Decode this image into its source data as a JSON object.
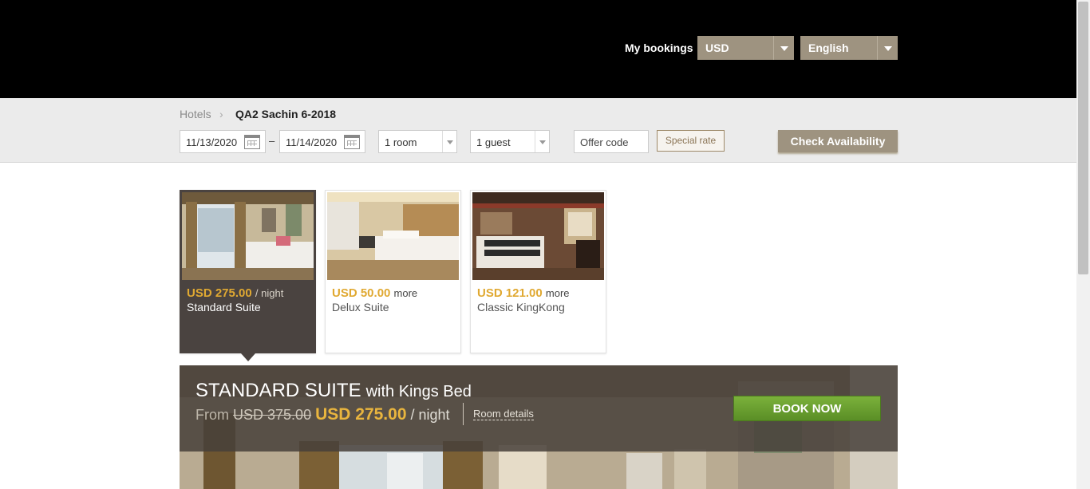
{
  "header": {
    "my_bookings": "My bookings",
    "currency": "USD",
    "language": "English"
  },
  "search": {
    "breadcrumb_hotels": "Hotels",
    "breadcrumb_separator": ">",
    "hotel_name": "QA2 Sachin 6-2018",
    "check_in": "11/13/2020",
    "date_separator": "–",
    "check_out": "11/14/2020",
    "rooms": "1 room",
    "guests": "1 guest",
    "offer_code_placeholder": "Offer code",
    "special_rate": "Special rate",
    "check_availability": "Check Availability"
  },
  "rooms": [
    {
      "price": "USD 275.00",
      "suffix": "/ night",
      "name": "Standard Suite",
      "selected": true
    },
    {
      "price": "USD 50.00",
      "suffix": "more",
      "name": "Delux Suite",
      "selected": false
    },
    {
      "price": "USD 121.00",
      "suffix": "more",
      "name": "Classic KingKong",
      "selected": false
    }
  ],
  "hero": {
    "title": "STANDARD SUITE",
    "subtitle": "with Kings Bed",
    "from_label": "From",
    "old_price": "USD 375.00",
    "new_price": "USD 275.00",
    "per_night": "/ night",
    "room_details": "Room details",
    "book_now": "BOOK NOW"
  },
  "colors": {
    "header_bg": "#000000",
    "dropdown_bg": "#9e9380",
    "accent_gold": "#e0a932",
    "book_green": "#6a9f30",
    "selected_card": "#4a4340"
  }
}
